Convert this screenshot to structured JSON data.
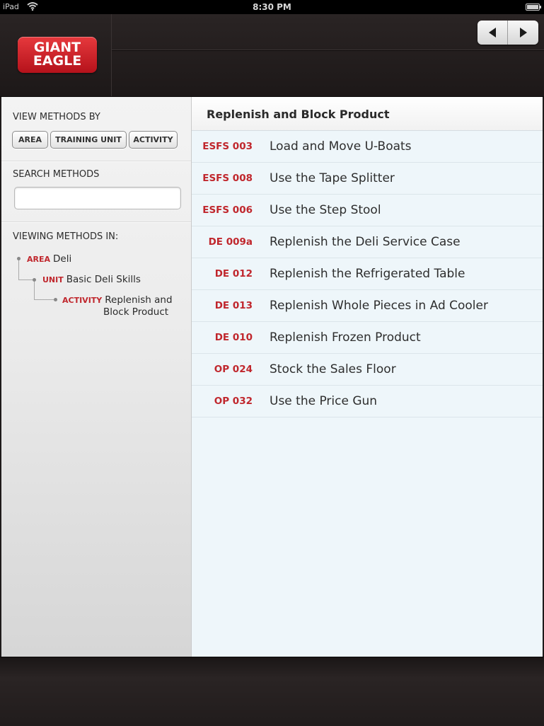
{
  "status_bar": {
    "device": "iPad",
    "time": "8:30 PM"
  },
  "header": {
    "logo": {
      "line1": "GIANT",
      "line2": "EAGLE"
    }
  },
  "sidebar": {
    "view_by_heading": "VIEW METHODS BY",
    "filters": [
      "AREA",
      "TRAINING UNIT",
      "ACTIVITY"
    ],
    "search_heading": "SEARCH METHODS",
    "search_value": "",
    "viewing_heading": "VIEWING METHODS IN:",
    "tree": {
      "area": {
        "keyword": "AREA",
        "value": "Deli"
      },
      "unit": {
        "keyword": "UNIT",
        "value": "Basic Deli Skills"
      },
      "activity": {
        "keyword": "ACTIVITY",
        "value_line1": "Replenish and",
        "value_line2": "Block Product"
      }
    }
  },
  "main": {
    "title": "Replenish and Block Product",
    "items": [
      {
        "code": "ESFS 003",
        "label": "Load and Move U-Boats"
      },
      {
        "code": "ESFS 008",
        "label": "Use the Tape Splitter"
      },
      {
        "code": "ESFS 006",
        "label": "Use the Step Stool"
      },
      {
        "code": "DE 009a",
        "label": "Replenish the Deli Service Case"
      },
      {
        "code": "DE 012",
        "label": "Replenish the Refrigerated Table"
      },
      {
        "code": "DE 013",
        "label": "Replenish Whole Pieces in Ad Cooler"
      },
      {
        "code": "DE 010",
        "label": "Replenish Frozen Product"
      },
      {
        "code": "OP 024",
        "label": "Stock the Sales Floor"
      },
      {
        "code": "OP 032",
        "label": "Use the Price Gun"
      }
    ]
  },
  "colors": {
    "accent_red": "#c0272d",
    "header_dark": "#1e1a1a",
    "list_background": "#eef6fa"
  },
  "icons": [
    "wifi-icon",
    "battery-icon",
    "back-arrow-icon",
    "forward-arrow-icon"
  ]
}
